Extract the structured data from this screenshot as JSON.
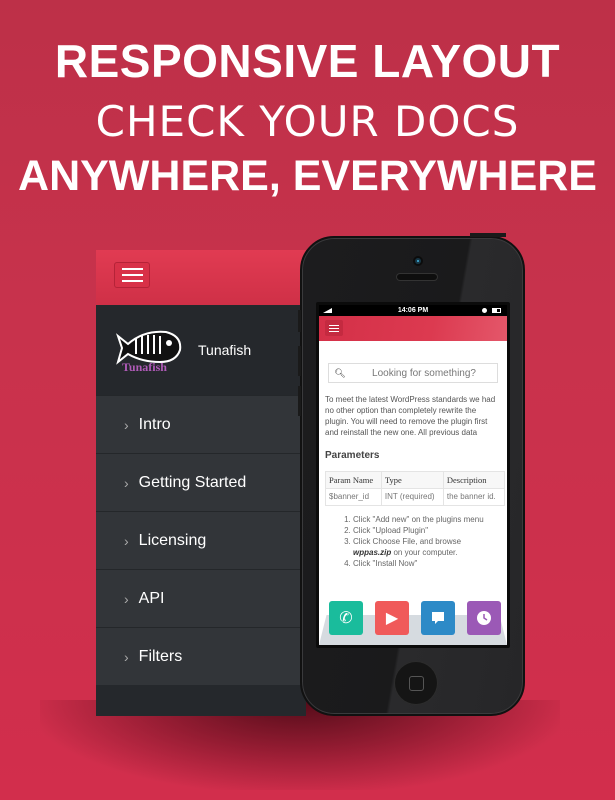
{
  "headline": {
    "line1": "RESPONSIVE LAYOUT",
    "line2": "CHECK YOUR DOCS",
    "line3": "ANYWHERE, EVERYWHERE"
  },
  "colors": {
    "brand_red": "#d8334a",
    "sidebar_bg": "#323539",
    "app_phone": "#1abc9c",
    "app_video": "#f05a5a",
    "app_chat": "#2d8ac7",
    "app_clock": "#9b59b6"
  },
  "desktop": {
    "menu_icon": "hamburger-icon",
    "brand_name": "Tunafish",
    "logo_text": "Tunafish",
    "nav_items": [
      {
        "label": "Intro"
      },
      {
        "label": "Getting Started"
      },
      {
        "label": "Licensing"
      },
      {
        "label": "API"
      },
      {
        "label": "Filters"
      }
    ]
  },
  "phone": {
    "status_time": "14:06 PM",
    "search_placeholder": "Looking for something?",
    "intro_text": "To meet the latest WordPress standards we had no other option than completely rewrite the plugin. You will need to remove the plugin first and reinstall the new one. All previous data",
    "params_heading": "Parameters",
    "table": {
      "headers": [
        "Param Name",
        "Type",
        "Description"
      ],
      "rows": [
        [
          "$banner_id",
          "INT (required)",
          "the banner id."
        ]
      ]
    },
    "steps": [
      "Click \"Add new\" on the plugins menu",
      "Click \"Upload Plugin\"",
      "Click Choose File, and browse",
      "Click \"Install Now\""
    ],
    "step3_file": "wppas.zip",
    "step3_suffix": " on your computer.",
    "dock_apps": [
      "phone-icon",
      "play-icon",
      "chat-icon",
      "clock-icon"
    ]
  }
}
